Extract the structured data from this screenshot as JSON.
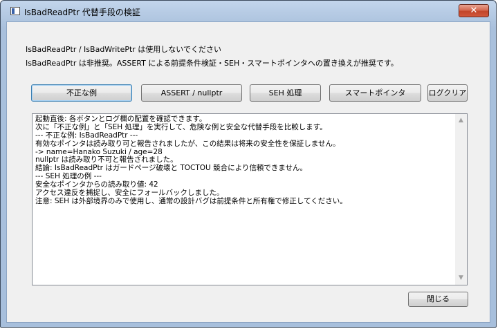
{
  "window": {
    "title": "IsBadReadPtr 代替手段の検証",
    "close_glyph": "✕"
  },
  "notices": [
    "IsBadReadPtr / IsBadWritePtr は使用しないでください",
    "IsBadReadPtr は非推奨。ASSERT による前提条件検証・SEH・スマートポインタへの置き換えが推奨です。"
  ],
  "buttons": {
    "bad_example": "不正な例",
    "assert": "ASSERT / nullptr",
    "seh": "SEH 処理",
    "smart_pointer": "スマートポインタ",
    "clear_log": "ログクリア",
    "close": "閉じる"
  },
  "log": [
    "起動直後: 各ボタンとログ欄の配置を確認できます。",
    "次に「不正な例」と「SEH 処理」を実行して、危険な例と安全な代替手段を比較します。",
    "--- 不正な例: IsBadReadPtr ---",
    "有効なポインタは読み取り可と報告されましたが、この結果は将来の安全性を保証しません。",
    "  -> name=Hanako Suzuki / age=28",
    "nullptr は読み取り不可と報告されました。",
    "結論: IsBadReadPtr はガードページ破壊と TOCTOU 競合により信頼できません。",
    "--- SEH 処理の例 ---",
    "安全なポインタからの読み取り値: 42",
    "アクセス違反を捕捉し、安全にフォールバックしました。",
    "注意: SEH は外部境界のみで使用し、通常の設計バグは前提条件と所有権で修正してください。"
  ],
  "scrollbar": {
    "up": "▲",
    "down": "▼"
  }
}
